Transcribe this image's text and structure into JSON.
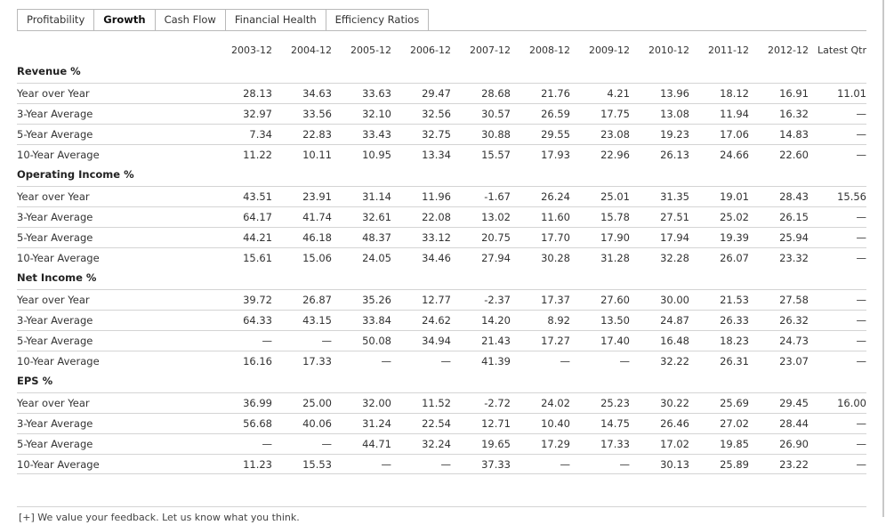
{
  "tabs": [
    {
      "label": "Profitability",
      "active": false
    },
    {
      "label": "Growth",
      "active": true
    },
    {
      "label": "Cash Flow",
      "active": false
    },
    {
      "label": "Financial Health",
      "active": false
    },
    {
      "label": "Efficiency Ratios",
      "active": false
    }
  ],
  "columns": [
    "2003-12",
    "2004-12",
    "2005-12",
    "2006-12",
    "2007-12",
    "2008-12",
    "2009-12",
    "2010-12",
    "2011-12",
    "2012-12",
    "Latest Qtr"
  ],
  "sections": [
    {
      "title": "Revenue %",
      "rows": [
        {
          "label": "Year over Year",
          "values": [
            "28.13",
            "34.63",
            "33.63",
            "29.47",
            "28.68",
            "21.76",
            "4.21",
            "13.96",
            "18.12",
            "16.91",
            "11.01"
          ]
        },
        {
          "label": "3-Year Average",
          "values": [
            "32.97",
            "33.56",
            "32.10",
            "32.56",
            "30.57",
            "26.59",
            "17.75",
            "13.08",
            "11.94",
            "16.32",
            "—"
          ]
        },
        {
          "label": "5-Year Average",
          "values": [
            "7.34",
            "22.83",
            "33.43",
            "32.75",
            "30.88",
            "29.55",
            "23.08",
            "19.23",
            "17.06",
            "14.83",
            "—"
          ]
        },
        {
          "label": "10-Year Average",
          "values": [
            "11.22",
            "10.11",
            "10.95",
            "13.34",
            "15.57",
            "17.93",
            "22.96",
            "26.13",
            "24.66",
            "22.60",
            "—"
          ]
        }
      ]
    },
    {
      "title": "Operating Income %",
      "rows": [
        {
          "label": "Year over Year",
          "values": [
            "43.51",
            "23.91",
            "31.14",
            "11.96",
            "-1.67",
            "26.24",
            "25.01",
            "31.35",
            "19.01",
            "28.43",
            "15.56"
          ]
        },
        {
          "label": "3-Year Average",
          "values": [
            "64.17",
            "41.74",
            "32.61",
            "22.08",
            "13.02",
            "11.60",
            "15.78",
            "27.51",
            "25.02",
            "26.15",
            "—"
          ]
        },
        {
          "label": "5-Year Average",
          "values": [
            "44.21",
            "46.18",
            "48.37",
            "33.12",
            "20.75",
            "17.70",
            "17.90",
            "17.94",
            "19.39",
            "25.94",
            "—"
          ]
        },
        {
          "label": "10-Year Average",
          "values": [
            "15.61",
            "15.06",
            "24.05",
            "34.46",
            "27.94",
            "30.28",
            "31.28",
            "32.28",
            "26.07",
            "23.32",
            "—"
          ]
        }
      ]
    },
    {
      "title": "Net Income %",
      "rows": [
        {
          "label": "Year over Year",
          "values": [
            "39.72",
            "26.87",
            "35.26",
            "12.77",
            "-2.37",
            "17.37",
            "27.60",
            "30.00",
            "21.53",
            "27.58",
            "—"
          ]
        },
        {
          "label": "3-Year Average",
          "values": [
            "64.33",
            "43.15",
            "33.84",
            "24.62",
            "14.20",
            "8.92",
            "13.50",
            "24.87",
            "26.33",
            "26.32",
            "—"
          ]
        },
        {
          "label": "5-Year Average",
          "values": [
            "—",
            "—",
            "50.08",
            "34.94",
            "21.43",
            "17.27",
            "17.40",
            "16.48",
            "18.23",
            "24.73",
            "—"
          ]
        },
        {
          "label": "10-Year Average",
          "values": [
            "16.16",
            "17.33",
            "—",
            "—",
            "41.39",
            "—",
            "—",
            "32.22",
            "26.31",
            "23.07",
            "—"
          ]
        }
      ]
    },
    {
      "title": "EPS %",
      "rows": [
        {
          "label": "Year over Year",
          "values": [
            "36.99",
            "25.00",
            "32.00",
            "11.52",
            "-2.72",
            "24.02",
            "25.23",
            "30.22",
            "25.69",
            "29.45",
            "16.00"
          ]
        },
        {
          "label": "3-Year Average",
          "values": [
            "56.68",
            "40.06",
            "31.24",
            "22.54",
            "12.71",
            "10.40",
            "14.75",
            "26.46",
            "27.02",
            "28.44",
            "—"
          ]
        },
        {
          "label": "5-Year Average",
          "values": [
            "—",
            "—",
            "44.71",
            "32.24",
            "19.65",
            "17.29",
            "17.33",
            "17.02",
            "19.85",
            "26.90",
            "—"
          ]
        },
        {
          "label": "10-Year Average",
          "values": [
            "11.23",
            "15.53",
            "—",
            "—",
            "37.33",
            "—",
            "—",
            "30.13",
            "25.89",
            "23.22",
            "—"
          ]
        }
      ]
    }
  ],
  "footer": {
    "text": "[+] We value your feedback. Let us know what you think."
  }
}
